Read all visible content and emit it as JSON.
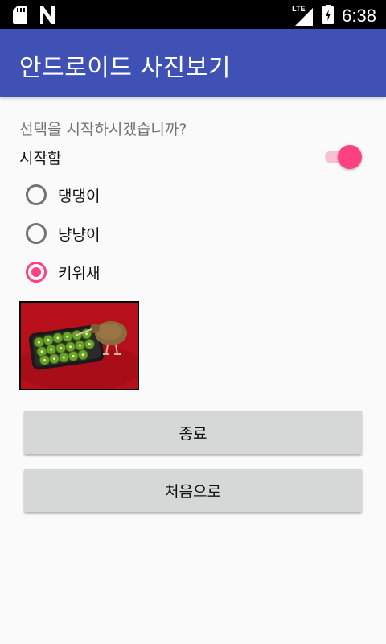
{
  "status_bar": {
    "time": "6:38",
    "network_label": "LTE",
    "icons": [
      "sd-card-icon",
      "n-logo-icon",
      "signal-icon",
      "battery-icon"
    ]
  },
  "app_bar": {
    "title": "안드로이드 사진보기",
    "color": "#3f51b5"
  },
  "main": {
    "question": "선택을 시작하시겠습니까?",
    "start_switch": {
      "label": "시작함",
      "checked": true,
      "accent": "#ff4081"
    },
    "radio_options": [
      {
        "label": "댕댕이",
        "checked": false
      },
      {
        "label": "냥냥이",
        "checked": false
      },
      {
        "label": "키위새",
        "checked": true
      }
    ],
    "photo": {
      "subject": "kiwi-bird-with-kiwi-fruit"
    },
    "buttons": {
      "end_label": "종료",
      "restart_label": "처음으로"
    }
  }
}
